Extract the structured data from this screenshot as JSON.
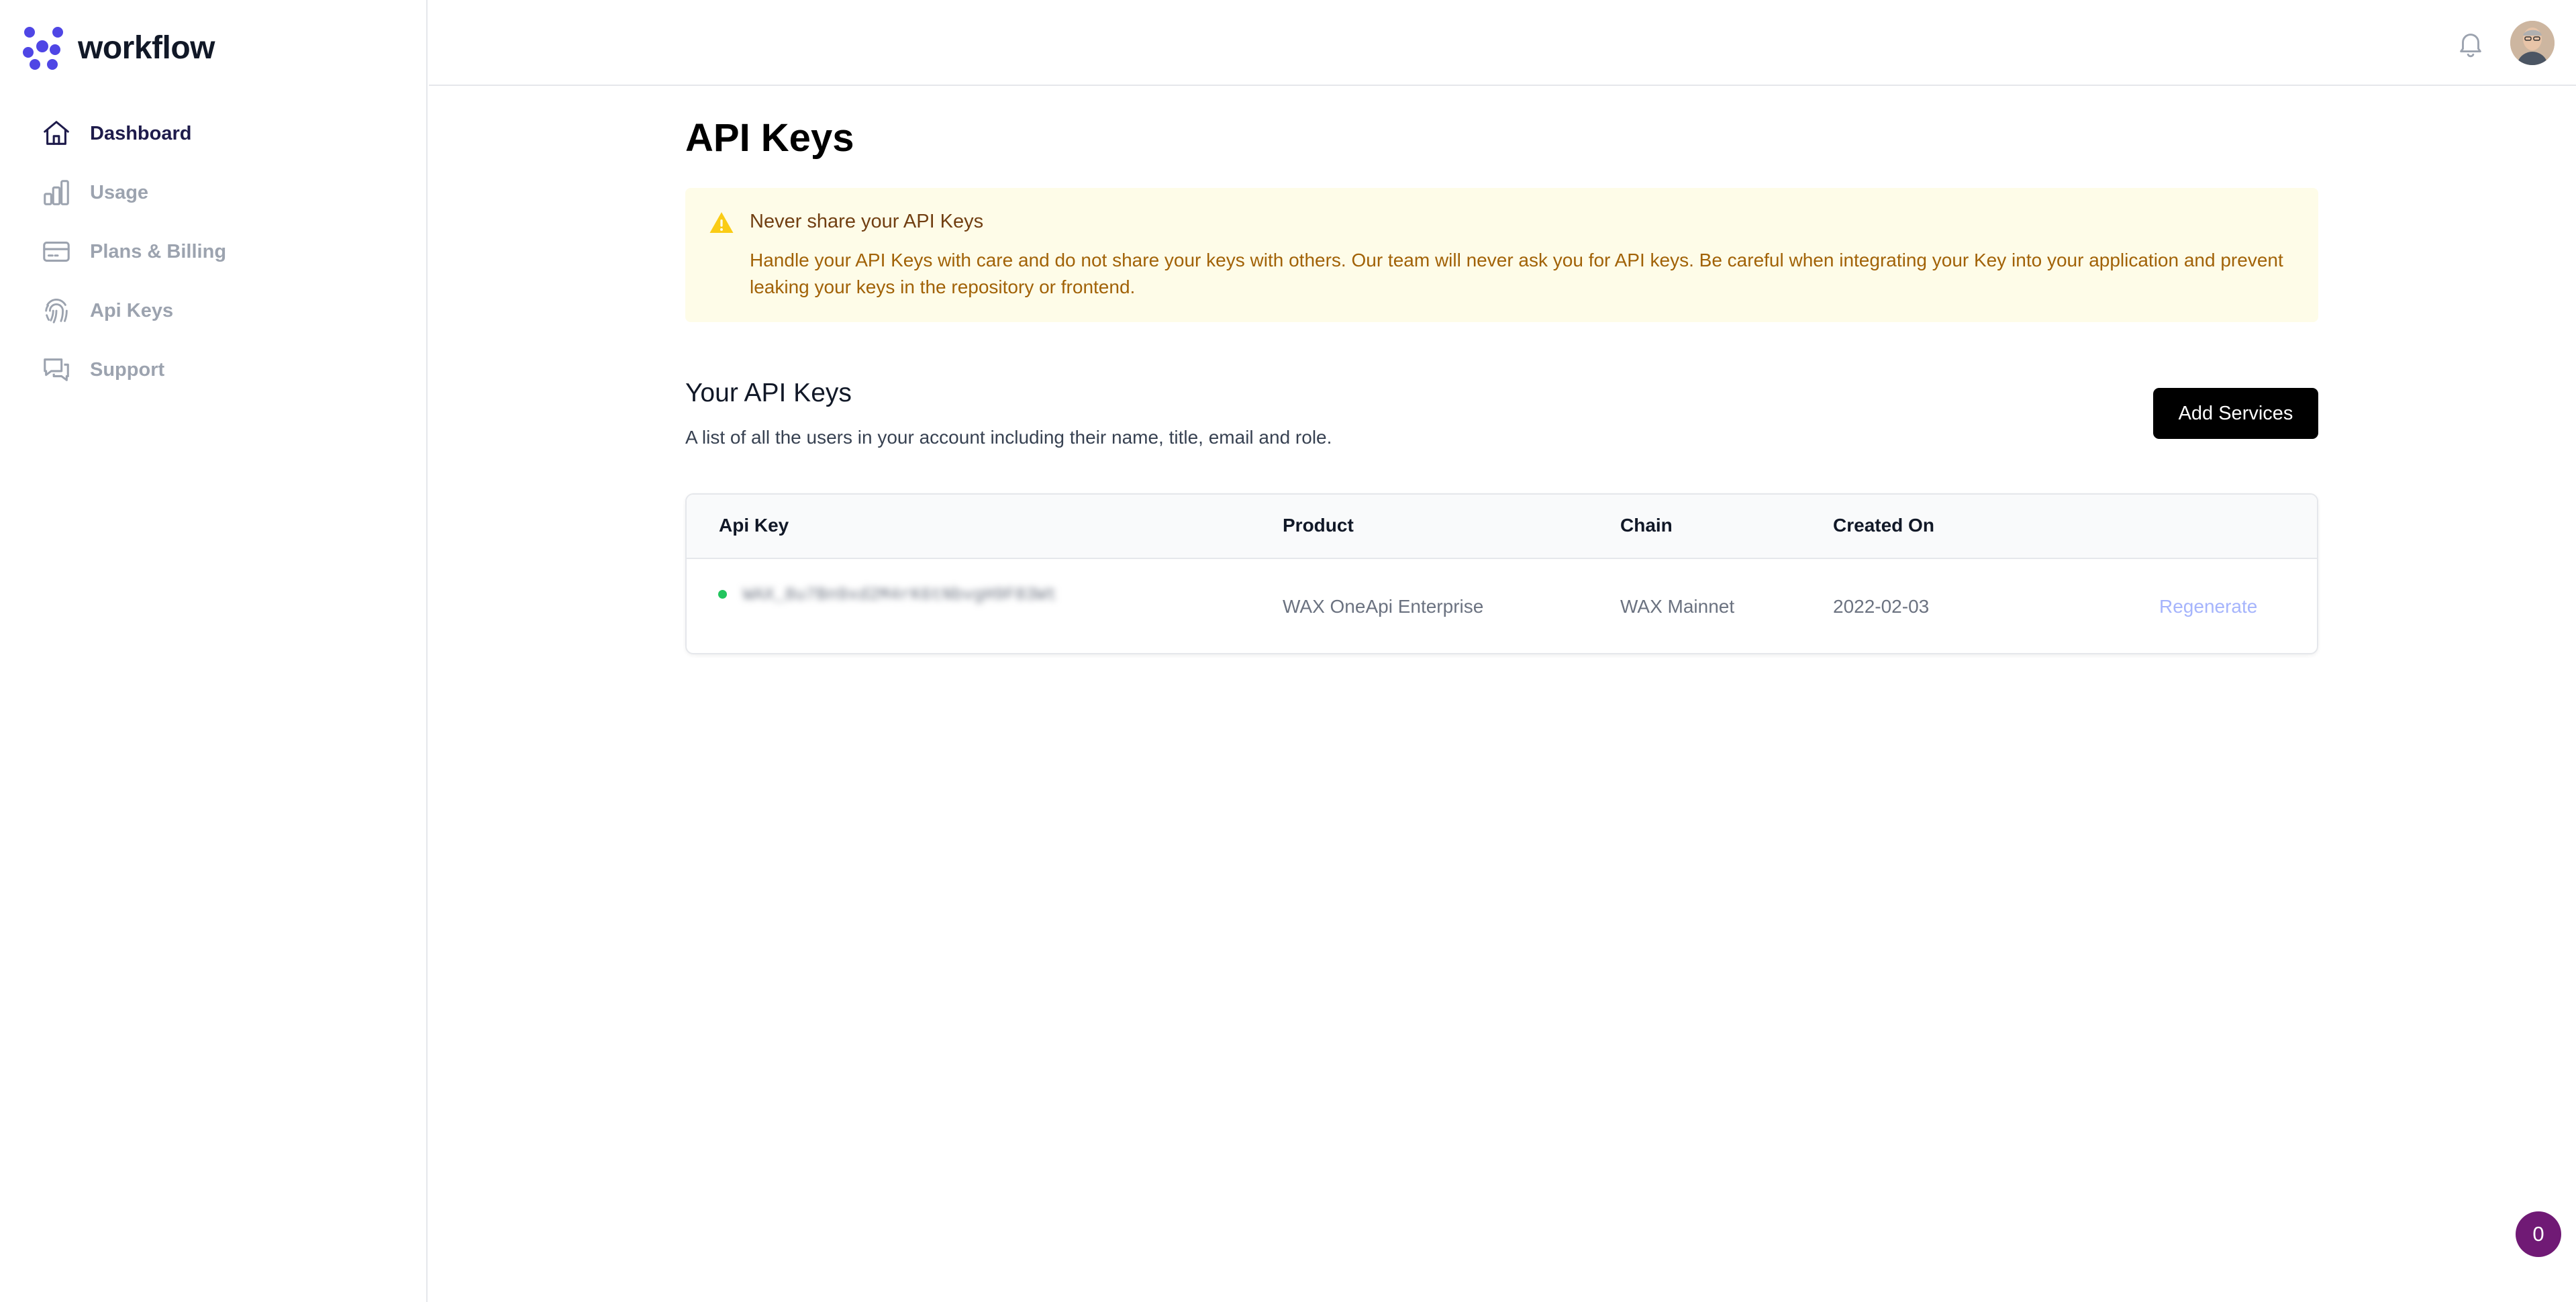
{
  "app": {
    "name": "workflow",
    "accent_color": "#4f46e5"
  },
  "sidebar": {
    "items": [
      {
        "label": "Dashboard",
        "icon": "home-icon",
        "active": true
      },
      {
        "label": "Usage",
        "icon": "bar-chart-icon",
        "active": false
      },
      {
        "label": "Plans & Billing",
        "icon": "credit-card-icon",
        "active": false
      },
      {
        "label": "Api Keys",
        "icon": "fingerprint-icon",
        "active": false
      },
      {
        "label": "Support",
        "icon": "chat-bubbles-icon",
        "active": false
      }
    ]
  },
  "header": {
    "notification_icon": "bell-icon",
    "avatar_icon": "user-avatar"
  },
  "main": {
    "title": "API Keys",
    "alert": {
      "icon": "warning-icon",
      "title": "Never share your API Keys",
      "body": "Handle your API Keys with care and do not share your keys with others. Our team will never ask you for API keys. Be careful when integrating your Key into your application and prevent leaking your keys in the repository or frontend."
    },
    "section": {
      "title": "Your API Keys",
      "description": "A list of all the users in your account including their name, title, email and role.",
      "add_button": "Add Services"
    },
    "table": {
      "columns": [
        "Api Key",
        "Product",
        "Chain",
        "Created On"
      ],
      "rows": [
        {
          "api_key": "WAX_8u7Bn9xd2M4rK6tNbvgH9F83Wt",
          "status": "active",
          "product": "WAX OneApi Enterprise",
          "chain": "WAX Mainnet",
          "created_on": "2022-02-03",
          "action": "Regenerate"
        }
      ]
    }
  },
  "chat_widget": {
    "count": "0"
  }
}
